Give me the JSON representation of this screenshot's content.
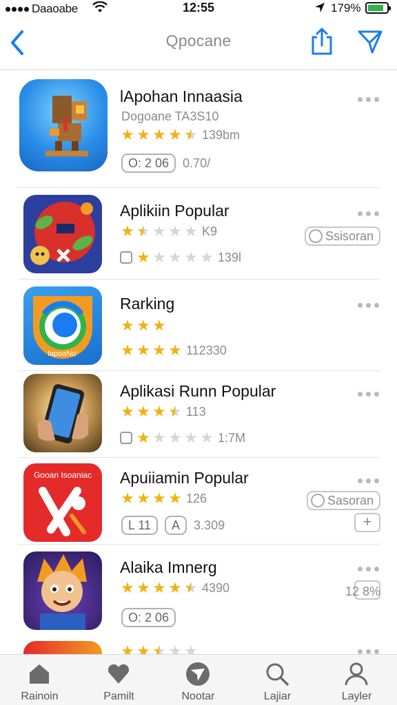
{
  "status_bar": {
    "carrier": "Daaoabe",
    "time": "12:55",
    "battery": "179%"
  },
  "nav": {
    "title": "Qpocane",
    "back_icon": "chevron-left-icon",
    "share_icon": "share-icon",
    "send_icon": "send-icon",
    "accent": "#1a7cf0"
  },
  "apps": [
    {
      "name": "lApohan Innaasia",
      "subtitle": "Dogoane TA3S10",
      "rating": 4.5,
      "rating_count": "139bm",
      "meta_pill": "O: 2  06",
      "meta_text": "0.70/"
    },
    {
      "name": "Aplikiin Popular",
      "rating": 1.5,
      "rating_count": "K9",
      "second_rating": 1,
      "second_count": "139l",
      "side_button": "Ssisoran"
    },
    {
      "name": "Rarking",
      "rating": 3,
      "second_rating": 4,
      "second_count": "112330",
      "icon_caption": "lapoaNo'"
    },
    {
      "name": "Aplikasi Runn Popular",
      "rating": 3.5,
      "rating_count": "113",
      "second_rating": 1,
      "second_count": "1:7M"
    },
    {
      "name": "Apuiiamin Popular",
      "rating": 4,
      "rating_count": "126",
      "meta_pill_1": "L 11",
      "meta_pill_2": "A",
      "meta_text": "3.309",
      "side_button": "Sasoran",
      "icon_caption": "Gooan Isoaniac"
    },
    {
      "name": "Alaika Imnerg",
      "rating": 4.5,
      "rating_count": "4390",
      "meta_pill": "O: 2  06",
      "side_text": "12 8%"
    },
    {
      "rating": 2.5
    }
  ],
  "tabs": [
    {
      "label": "Rainoin",
      "icon": "home-icon"
    },
    {
      "label": "Pamilt",
      "icon": "heart-icon"
    },
    {
      "label": "Nootar",
      "icon": "navigate-icon"
    },
    {
      "label": "Lajiar",
      "icon": "search-icon"
    },
    {
      "label": "Layler",
      "icon": "person-icon"
    }
  ]
}
